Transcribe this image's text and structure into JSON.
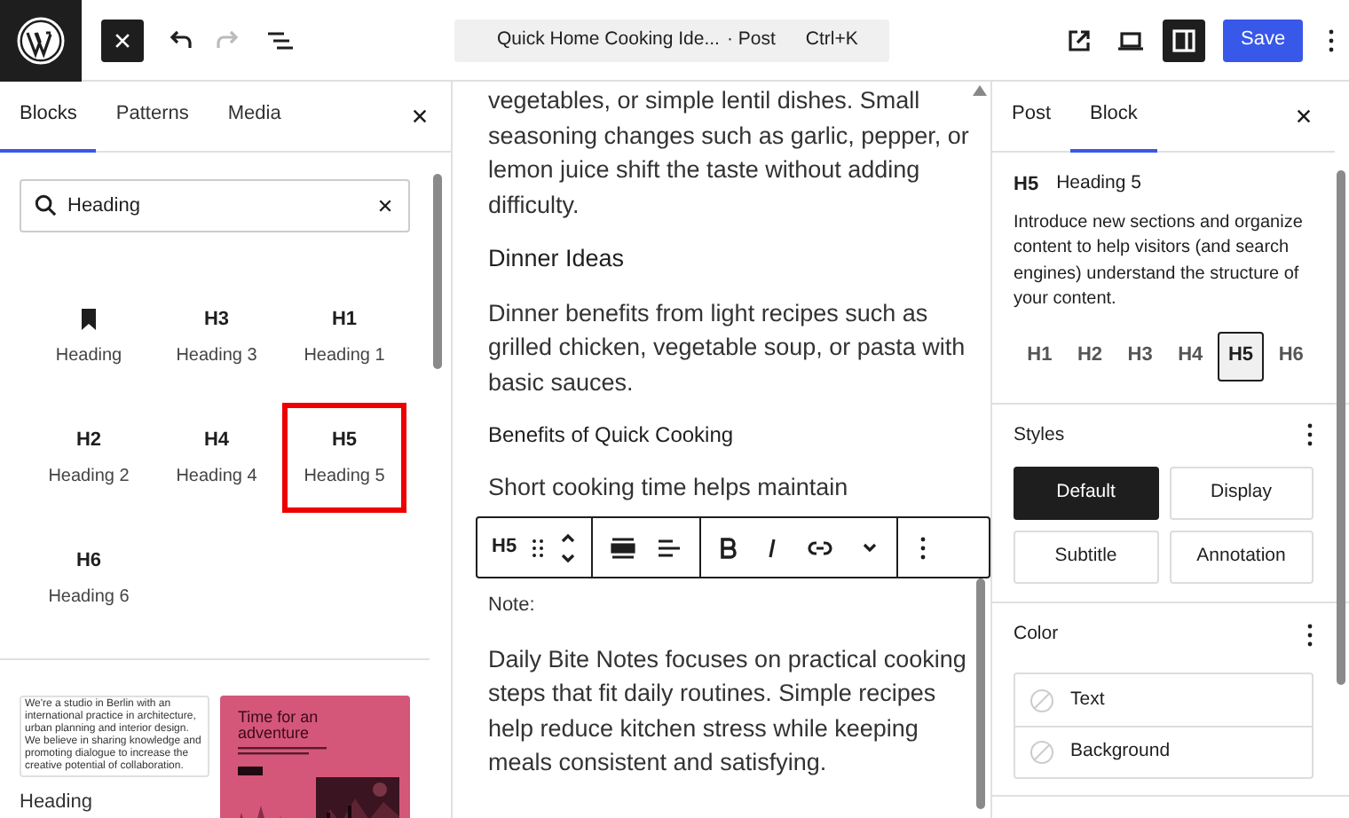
{
  "topbar": {
    "title": "Quick Home Cooking Ide...",
    "post_type": "· Post",
    "shortcut": "Ctrl+K",
    "save": "Save",
    "settings_open": true
  },
  "inserter": {
    "tabs": [
      {
        "label": "Blocks",
        "selected": true
      },
      {
        "label": "Patterns",
        "selected": false
      },
      {
        "label": "Media",
        "selected": false
      }
    ],
    "search": {
      "value": "Heading"
    },
    "blocks": [
      {
        "kind": "bookmark",
        "label": "Heading",
        "marked": false
      },
      {
        "kind": "text",
        "icon": "H3",
        "label": "Heading 3",
        "marked": false
      },
      {
        "kind": "text",
        "icon": "H1",
        "label": "Heading 1",
        "marked": false
      },
      {
        "kind": "text",
        "icon": "H2",
        "label": "Heading 2",
        "marked": false
      },
      {
        "kind": "text",
        "icon": "H4",
        "label": "Heading 4",
        "marked": false
      },
      {
        "kind": "text",
        "icon": "H5",
        "label": "Heading 5",
        "marked": true
      },
      {
        "kind": "text",
        "icon": "H6",
        "label": "Heading 6",
        "marked": false
      }
    ],
    "patterns": [
      {
        "kind": "text",
        "preview_text": "We're a studio in Berlin with an international practice in architecture, urban planning and interior design. We believe in sharing knowledge and promoting dialogue to increase the creative potential of collaboration.",
        "label": "Heading"
      },
      {
        "kind": "poster",
        "preview_title": "Time for an adventure"
      }
    ]
  },
  "editor": {
    "blocks": [
      {
        "kind": "paragraph",
        "text": "vegetables, or simple lentil dishes. Small seasoning changes such as garlic, pepper, or lemon juice shift the taste without adding difficulty."
      },
      {
        "kind": "heading",
        "text": "Dinner Ideas"
      },
      {
        "kind": "paragraph",
        "text": "Dinner benefits from light recipes such as grilled chicken, vegetable soup, or pasta with basic sauces."
      },
      {
        "kind": "subheading",
        "text": "Benefits of Quick Cooking"
      },
      {
        "kind": "paragraph",
        "text": "Short cooking time helps maintain"
      },
      {
        "kind": "note",
        "text": "Note:"
      },
      {
        "kind": "paragraph",
        "text": "Daily Bite Notes focuses on practical cooking steps that fit daily routines. Simple recipes help reduce kitchen stress while keeping meals consistent and satisfying."
      }
    ],
    "toolbar": {
      "level": "H5"
    }
  },
  "settings": {
    "tabs": [
      {
        "label": "Post",
        "selected": false
      },
      {
        "label": "Block",
        "selected": true
      }
    ],
    "block": {
      "icon": "H5",
      "name": "Heading 5",
      "description": "Introduce new sections and organize content to help visitors (and search engines) understand the structure of your content."
    },
    "levels": [
      {
        "label": "H1",
        "selected": false
      },
      {
        "label": "H2",
        "selected": false
      },
      {
        "label": "H3",
        "selected": false
      },
      {
        "label": "H4",
        "selected": false
      },
      {
        "label": "H5",
        "selected": true
      },
      {
        "label": "H6",
        "selected": false
      }
    ],
    "styles": {
      "title": "Styles",
      "options": [
        {
          "label": "Default",
          "selected": true
        },
        {
          "label": "Display",
          "selected": false
        },
        {
          "label": "Subtitle",
          "selected": false
        },
        {
          "label": "Annotation",
          "selected": false
        }
      ]
    },
    "color": {
      "title": "Color",
      "items": [
        {
          "label": "Text"
        },
        {
          "label": "Background"
        }
      ]
    }
  }
}
